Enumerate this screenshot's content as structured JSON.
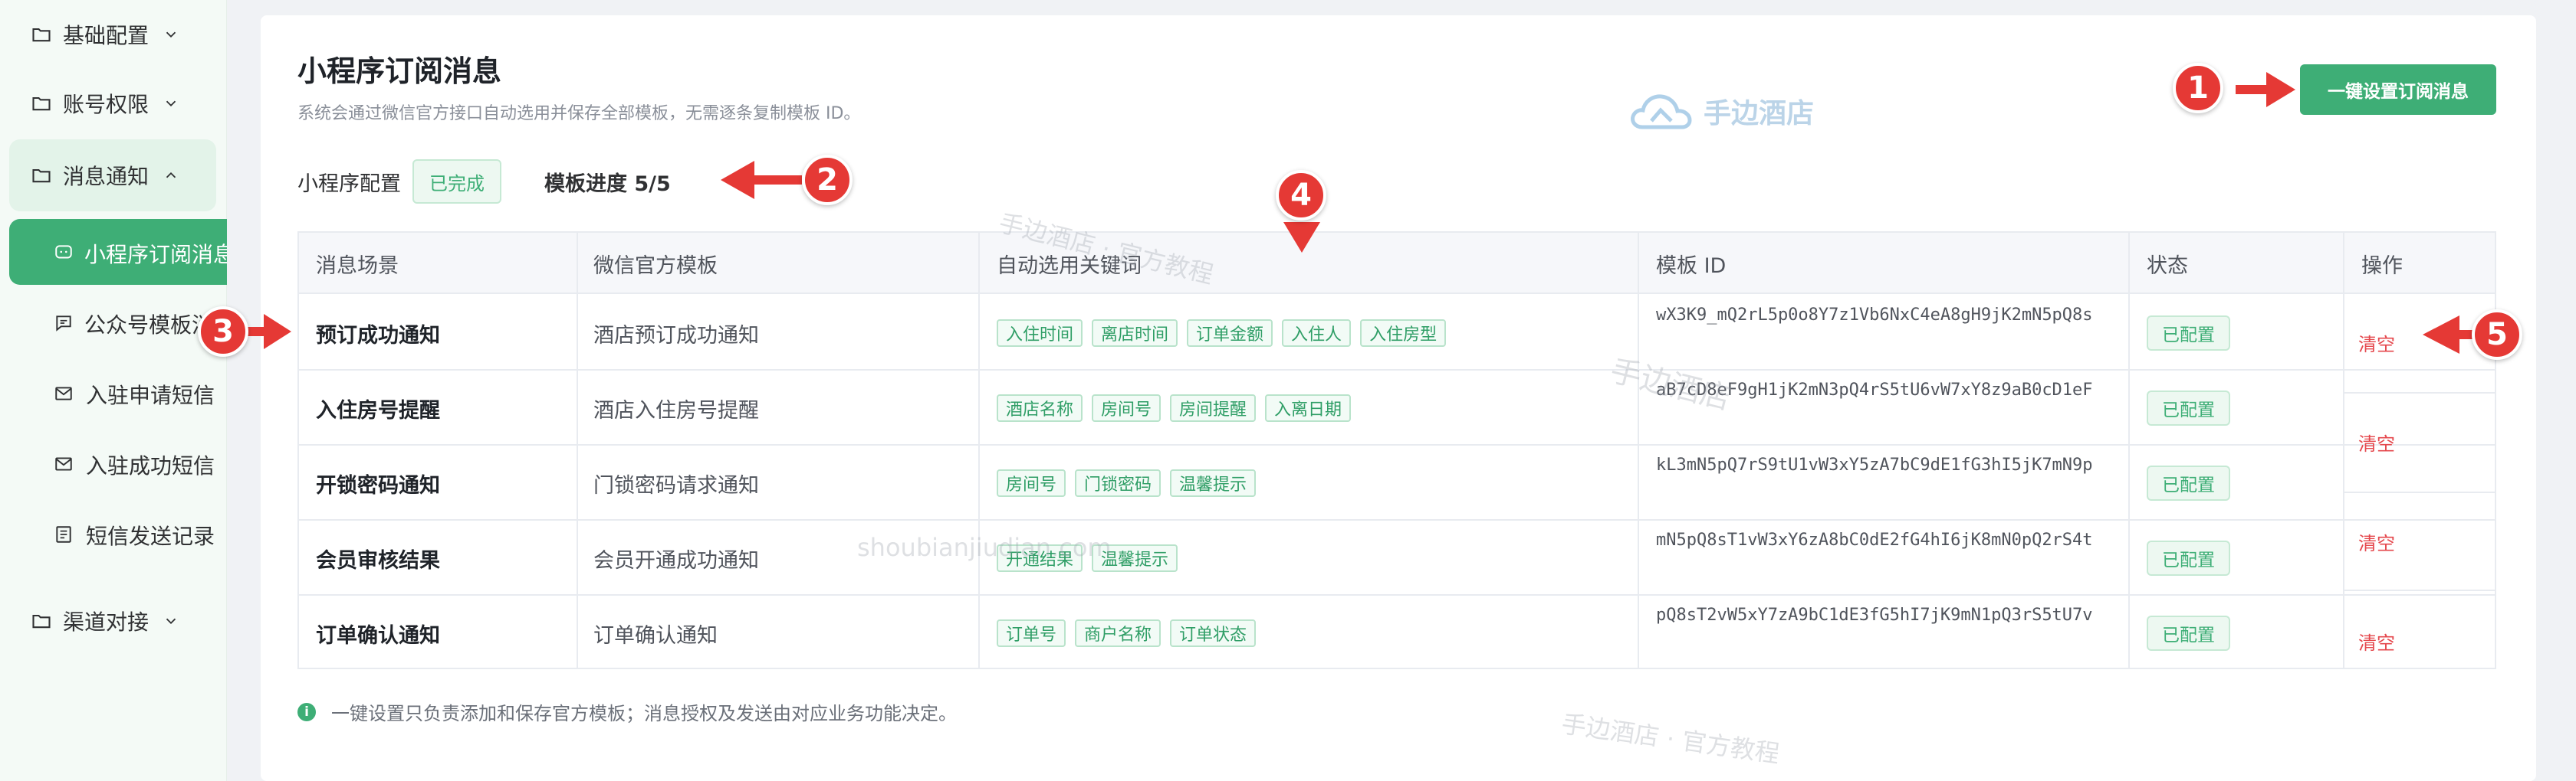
{
  "sidebar": {
    "items": [
      {
        "label": "基础配置",
        "icon": "folder-icon"
      },
      {
        "label": "账号权限",
        "icon": "folder-icon"
      },
      {
        "label": "消息通知",
        "icon": "folder-icon"
      },
      {
        "label": "渠道对接",
        "icon": "folder-icon"
      }
    ],
    "submenu": [
      {
        "label": "小程序订阅消息",
        "icon": "chat-icon"
      },
      {
        "label": "公众号模板消息",
        "icon": "message-icon"
      },
      {
        "label": "入驻申请短信",
        "icon": "mail-icon"
      },
      {
        "label": "入驻成功短信",
        "icon": "mail-icon"
      },
      {
        "label": "短信发送记录",
        "icon": "list-icon"
      }
    ]
  },
  "header": {
    "title": "小程序订阅消息",
    "subtitle": "系统会通过微信官方接口自动选用并保存全部模板，无需逐条复制模板 ID。",
    "action_button": "一键设置订阅消息"
  },
  "status_bar": {
    "config_label": "小程序配置",
    "config_status": "已完成",
    "progress_label": "模板进度 5/5"
  },
  "table": {
    "columns": [
      "消息场景",
      "微信官方模板",
      "自动选用关键词",
      "模板 ID",
      "状态",
      "操作"
    ],
    "rows": [
      {
        "scene": "预订成功通知",
        "template": "酒店预订成功通知",
        "keywords": [
          "入住时间",
          "离店时间",
          "订单金额",
          "入住人",
          "入住房型"
        ],
        "template_id": "wX3K9_mQ2rL5p0o8Y7z1Vb6NxC4eA8gH9jK2mN5pQ8s",
        "status": "已配置",
        "action": "清空"
      },
      {
        "scene": "入住房号提醒",
        "template": "酒店入住房号提醒",
        "keywords": [
          "酒店名称",
          "房间号",
          "房间提醒",
          "入离日期"
        ],
        "template_id": "aB7cD8eF9gH1jK2mN3pQ4rS5tU6vW7xY8z9aB0cD1eF",
        "status": "已配置",
        "action": "清空"
      },
      {
        "scene": "开锁密码通知",
        "template": "门锁密码请求通知",
        "keywords": [
          "房间号",
          "门锁密码",
          "温馨提示"
        ],
        "template_id": "kL3mN5pQ7rS9tU1vW3xY5zA7bC9dE1fG3hI5jK7mN9p",
        "status": "已配置",
        "action": "清空"
      },
      {
        "scene": "会员审核结果",
        "template": "会员开通成功通知",
        "keywords": [
          "开通结果",
          "温馨提示"
        ],
        "template_id": "mN5pQ8sT1vW3xY6zA8bC0dE2fG4hI6jK8mN0pQ2rS4t",
        "status": "已配置",
        "action": "清空"
      },
      {
        "scene": "订单确认通知",
        "template": "订单确认通知",
        "keywords": [
          "订单号",
          "商户名称",
          "订单状态"
        ],
        "template_id": "pQ8sT2vW5xY7zA9bC1dE3fG5hI7jK9mN1pQ3rS5tU7v",
        "status": "已配置",
        "action": "清空"
      }
    ]
  },
  "footer_note": "一键设置只负责添加和保存官方模板；消息授权及发送由对应业务功能决定。",
  "watermarks": {
    "logo_text": "手边酒店",
    "text1": "手边酒店 · 官方教程",
    "text2": "shoubianjiudian.com",
    "text3": "手边酒店 · 官方教程",
    "text4": "手边酒店"
  },
  "annotations": [
    "1",
    "2",
    "3",
    "4",
    "5"
  ],
  "colors": {
    "accent": "#3eae76",
    "danger": "#e5484d",
    "annotation": "#e53935"
  }
}
